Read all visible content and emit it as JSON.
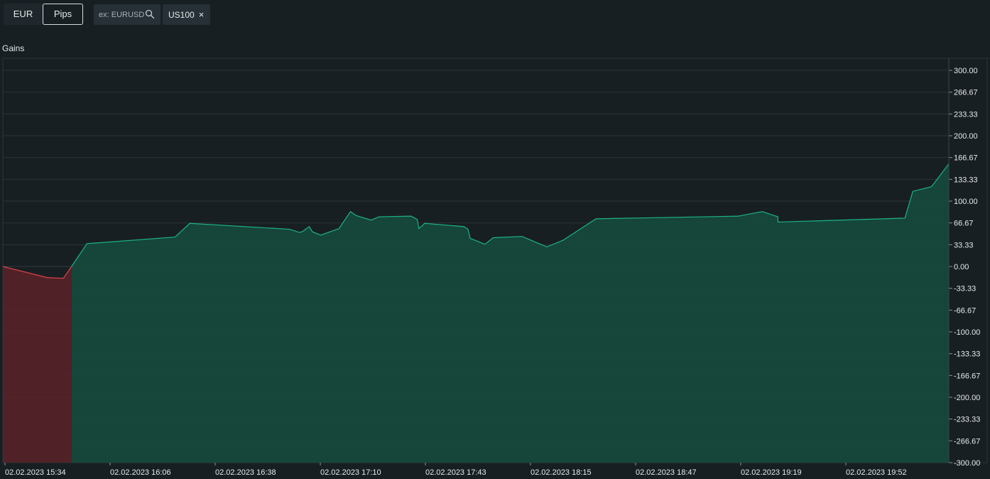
{
  "toolbar": {
    "unit_options": [
      "EUR",
      "Pips"
    ],
    "selected_unit": "Pips",
    "search_placeholder": "ex: EURUSD",
    "active_symbol": "US100",
    "close_glyph": "×"
  },
  "icons": {
    "search": "search-icon",
    "close": "close-icon"
  },
  "colors": {
    "background": "#181f23",
    "grid": "#2b3439",
    "positive_line": "#1db387",
    "positive_fill": "#154a3c",
    "negative_line": "#e0424a",
    "negative_fill": "#5a2328",
    "text": "#e6e9eb"
  },
  "chart_data": {
    "type": "area",
    "title": "Gains",
    "xlabel": "",
    "ylabel": "",
    "ylim": [
      -300,
      300
    ],
    "grid": true,
    "y_ticks": [
      "300.00",
      "266.67",
      "233.33",
      "200.00",
      "166.67",
      "133.33",
      "100.00",
      "66.67",
      "33.33",
      "0.00",
      "-33.33",
      "-66.67",
      "-100.00",
      "-133.33",
      "-166.67",
      "-200.00",
      "-233.33",
      "-266.67",
      "-300.00"
    ],
    "x_ticks": [
      "02.02.2023 15:34",
      "02.02.2023 16:06",
      "02.02.2023 16:38",
      "02.02.2023 17:10",
      "02.02.2023 17:43",
      "02.02.2023 18:15",
      "02.02.2023 18:47",
      "02.02.2023 19:19",
      "02.02.2023 19:52"
    ],
    "x_range_min": [
      0,
      289
    ],
    "series": [
      {
        "x": [
          0,
          13.6,
          18.5,
          21.0,
          25.7,
          52.6,
          57.1,
          87.6,
          90.7,
          91.7,
          93.6,
          94.6,
          97.1,
          102.7,
          106.2,
          107.9,
          112.5,
          114.9,
          124.7,
          126.6,
          127.1,
          128.9,
          140.9,
          142.1,
          142.8,
          147.3,
          149.8,
          158.6,
          166.2,
          171.1,
          181.2,
          224.6,
          232.0,
          236.8,
          236.8,
          275.6,
          278.0,
          283.7,
          289.0
        ],
        "y": [
          0,
          -17,
          -18,
          0,
          35,
          45,
          66,
          57,
          52,
          54,
          61,
          53,
          48,
          58,
          84,
          78,
          71,
          76,
          77,
          72,
          58,
          66,
          61,
          57,
          43,
          34,
          44,
          46,
          30,
          40,
          73,
          77,
          84,
          76,
          68,
          74,
          115,
          122,
          157
        ]
      }
    ]
  }
}
